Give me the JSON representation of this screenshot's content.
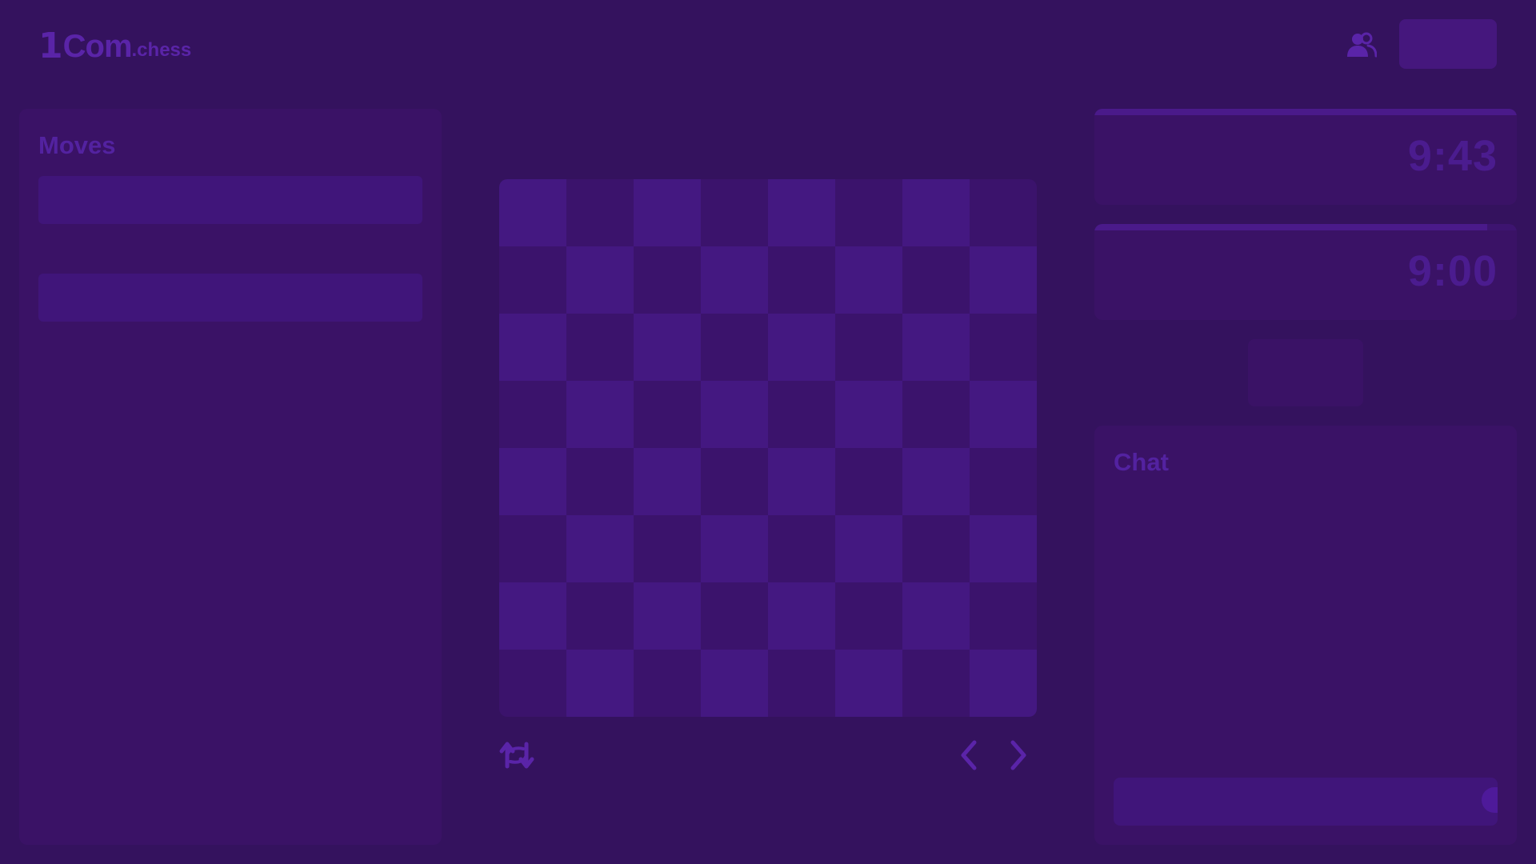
{
  "header": {
    "logo": {
      "mark": "1",
      "big": "Com",
      "small": ".chess"
    },
    "friends_icon": "friends-icon",
    "action_button_label": ""
  },
  "moves": {
    "title": "Moves",
    "rows": [
      "",
      ""
    ]
  },
  "board": {
    "flip_icon": "flip-board-icon",
    "prev_icon": "chevron-left-icon",
    "next_icon": "chevron-right-icon"
  },
  "clocks": {
    "opponent": {
      "time": "9:43",
      "progress": 1.0
    },
    "player": {
      "time": "9:00",
      "progress": 0.93
    }
  },
  "chat": {
    "title": "Chat",
    "input_value": "",
    "input_placeholder": ""
  },
  "colors": {
    "background": "#34125e",
    "panel": "#3a1266",
    "accent": "#5a24a8"
  }
}
